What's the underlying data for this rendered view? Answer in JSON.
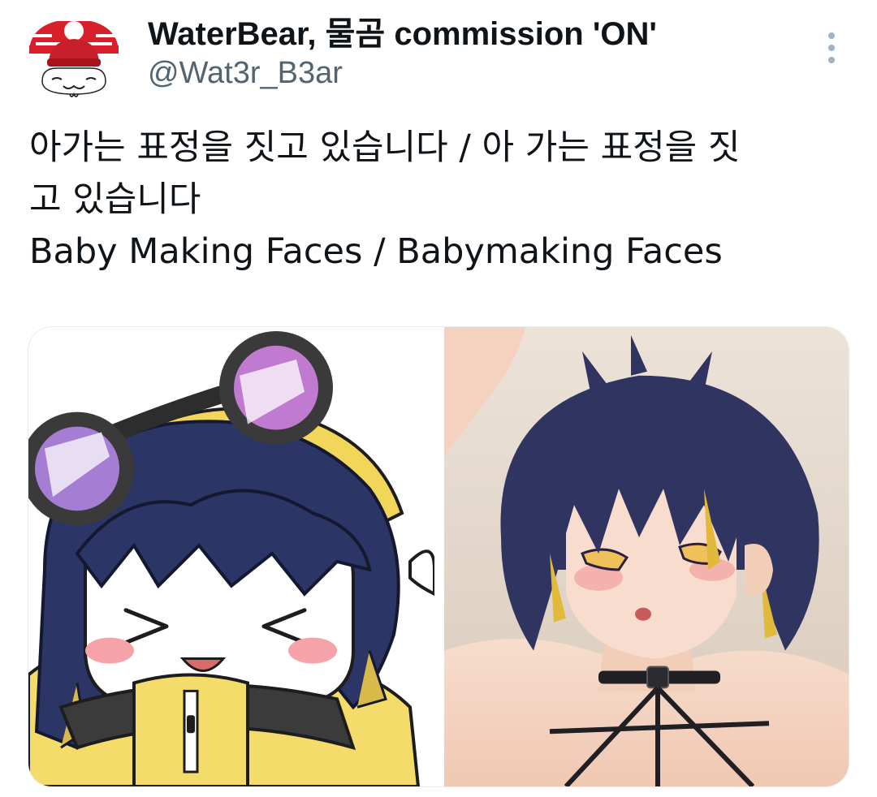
{
  "author": {
    "display_name": "WaterBear, 물곰 commission 'ON'",
    "handle": "@Wat3r_B3ar",
    "avatar_icon": "waterbear-avatar-icon"
  },
  "more_icon": "more-dots-icon",
  "tweet": {
    "lines": [
      "아가는 표정을 짓고 있습니다 / 아 가는 표정을 짓",
      "고 있습니다",
      "Baby Making Faces / Babymaking Faces"
    ]
  },
  "media": [
    {
      "kind": "chibi-illustration"
    },
    {
      "kind": "anime-illustration"
    }
  ],
  "colors": {
    "text_primary": "#0f1419",
    "text_secondary": "#536471",
    "avatar_red": "#d9202a"
  }
}
